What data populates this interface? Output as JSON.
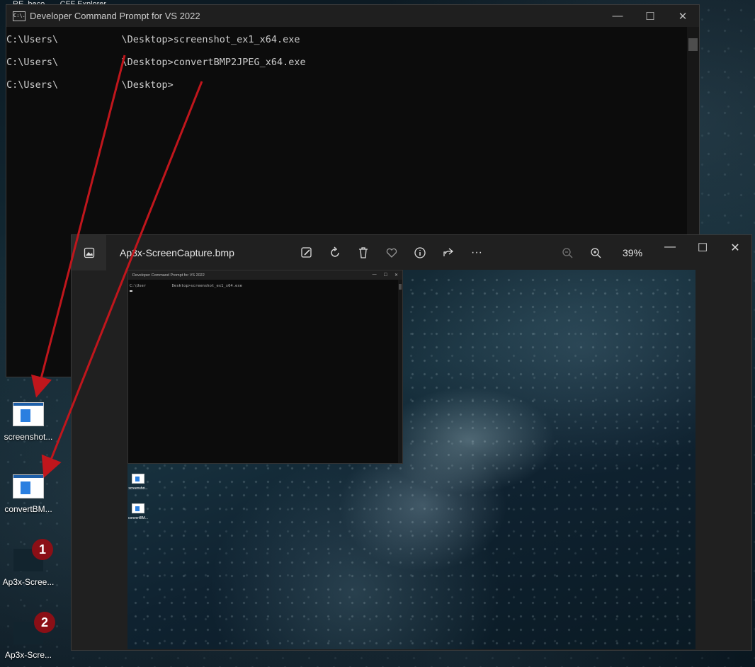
{
  "desktop": {
    "top_fragment_1": "RE_beco",
    "top_fragment_2": "CFF Explorer",
    "icons": [
      {
        "label": "screenshot...",
        "icon": "exe-window-icon"
      },
      {
        "label": "convertBM...",
        "icon": "exe-window-icon"
      },
      {
        "label": "Ap3x-Scree...",
        "icon": "bmp-file-icon",
        "badge": "1"
      },
      {
        "label": "Ap3x-Scre...",
        "icon": "jpeg-file-icon",
        "badge": "2"
      }
    ]
  },
  "cmd": {
    "title": "Developer Command Prompt for VS 2022",
    "app_icon_text": "C:\\.",
    "lines": [
      "C:\\Users\\           \\Desktop>screenshot_ex1_x64.exe",
      "C:\\Users\\           \\Desktop>convertBMP2JPEG_x64.exe",
      "C:\\Users\\           \\Desktop>"
    ],
    "controls": {
      "minimize": "—",
      "maximize": "☐",
      "close": "✕"
    }
  },
  "viewer": {
    "title": "Ap3x-ScreenCapture.bmp",
    "zoom": "39%",
    "tools": [
      "edit-icon",
      "rotate-icon",
      "delete-icon",
      "favorite-icon",
      "info-icon",
      "share-icon",
      "more-icon"
    ],
    "more_label": "···",
    "controls": {
      "minimize": "—",
      "maximize": "☐",
      "close": "✕"
    },
    "thumbnail": {
      "title": "Developer Command Prompt for VS 2022",
      "line": "C:\\User           Desktop>screenshot_ex1_x64.exe",
      "icons": [
        "screensho...",
        "convertBM..."
      ]
    }
  },
  "colors": {
    "arrow": "#c0161c",
    "badge": "#8b0f16"
  }
}
